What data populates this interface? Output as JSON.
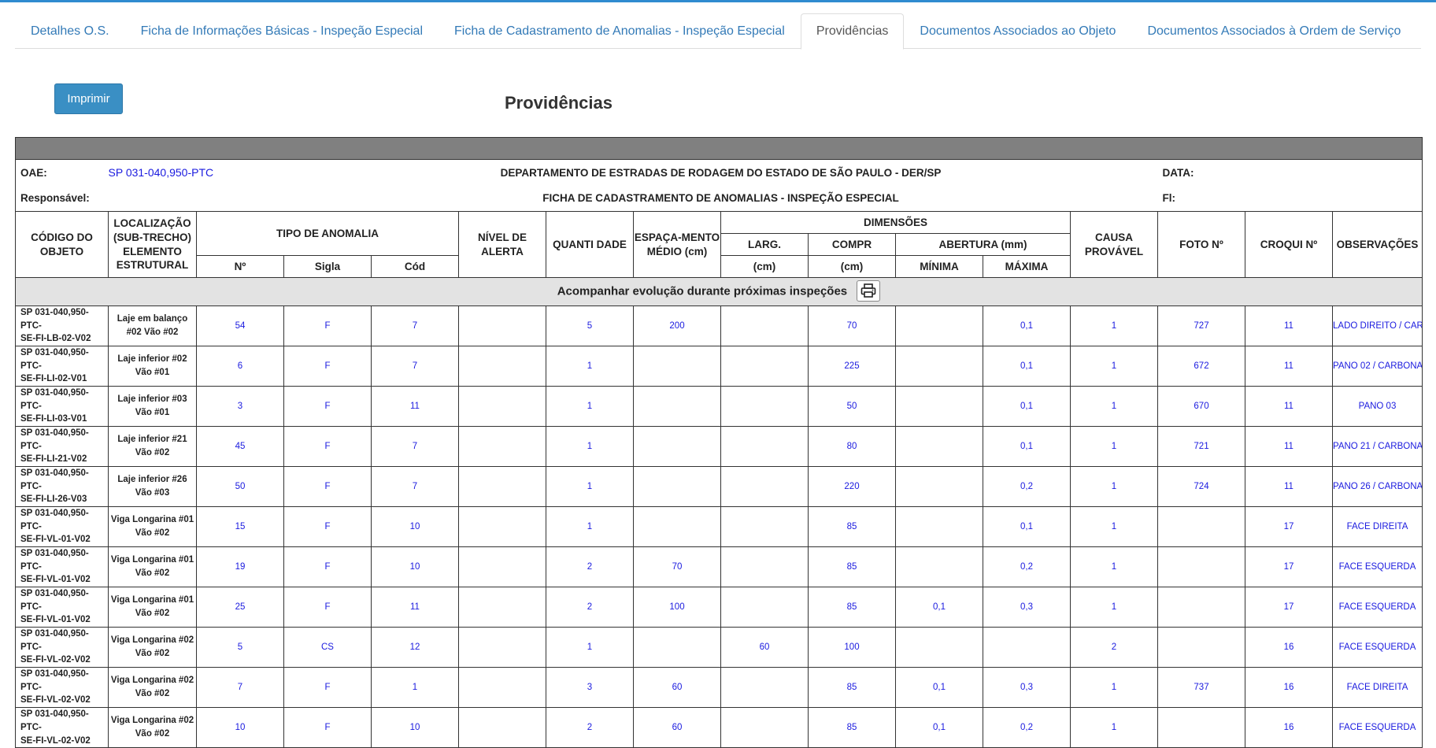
{
  "tabs": [
    {
      "label": "Detalhes O.S.",
      "active": false
    },
    {
      "label": "Ficha de Informações Básicas - Inspeção Especial",
      "active": false
    },
    {
      "label": "Ficha de Cadastramento de Anomalias - Inspeção Especial",
      "active": false
    },
    {
      "label": "Providências",
      "active": true
    },
    {
      "label": "Documentos Associados ao Objeto",
      "active": false
    },
    {
      "label": "Documentos Associados à Ordem de Serviço",
      "active": false
    }
  ],
  "toolbar": {
    "print_label": "Imprimir"
  },
  "page_title": "Providências",
  "info": {
    "oae_label": "OAE:",
    "oae_value": "SP 031-040,950-PTC",
    "department": "DEPARTAMENTO DE ESTRADAS DE RODAGEM DO ESTADO DE SÃO PAULO - DER/SP",
    "data_label": "DATA:",
    "responsavel_label": "Responsável:",
    "form_title": "FICHA DE CADASTRAMENTO DE ANOMALIAS - INSPEÇÃO ESPECIAL",
    "fl_label": "Fl:"
  },
  "headers": {
    "codigo": "CÓDIGO DO OBJETO",
    "localizacao": "LOCALIZAÇÃO (SUB-TRECHO) ELEMENTO ESTRUTURAL",
    "tipo": "TIPO DE ANOMALIA",
    "no": "Nº",
    "sigla": "Sigla",
    "cod": "Cód",
    "nivel": "NÍVEL DE ALERTA",
    "quantidade": "QUANTI DADE",
    "espacamento": "ESPAÇA-MENTO MÉDIO (cm)",
    "dimensoes": "DIMENSÕES",
    "larg": "LARG.",
    "compr": "COMPR",
    "abertura": "ABERTURA (mm)",
    "cm1": "(cm)",
    "cm2": "(cm)",
    "minima": "MÍNIMA",
    "maxima": "MÁXIMA",
    "causa": "CAUSA PROVÁVEL",
    "foto": "FOTO Nº",
    "croqui": "CROQUI Nº",
    "obs": "OBSERVAÇÕES"
  },
  "section_label": "Acompanhar evolução durante próximas inspeções",
  "section_icon": "printer-icon",
  "rows": [
    {
      "code1": "SP 031-040,950-PTC-",
      "code2": "SE-FI-LB-02-V02",
      "loc1": "Laje em balanço",
      "loc2": "#02 Vão #02",
      "no": "54",
      "sigla": "F",
      "cod": "7",
      "nivel": "",
      "qtd": "5",
      "esp": "200",
      "larg": "",
      "compr": "70",
      "min": "",
      "max": "0,1",
      "causa": "1",
      "foto": "727",
      "croqui": "11",
      "obs": "LADO  DIREITO / CAR"
    },
    {
      "code1": "SP 031-040,950-PTC-",
      "code2": "SE-FI-LI-02-V01",
      "loc1": "Laje inferior #02",
      "loc2": "Vão #01",
      "no": "6",
      "sigla": "F",
      "cod": "7",
      "nivel": "",
      "qtd": "1",
      "esp": "",
      "larg": "",
      "compr": "225",
      "min": "",
      "max": "0,1",
      "causa": "1",
      "foto": "672",
      "croqui": "11",
      "obs": "PANO 02 / CARBONA"
    },
    {
      "code1": "SP 031-040,950-PTC-",
      "code2": "SE-FI-LI-03-V01",
      "loc1": "Laje inferior #03",
      "loc2": "Vão #01",
      "no": "3",
      "sigla": "F",
      "cod": "11",
      "nivel": "",
      "qtd": "1",
      "esp": "",
      "larg": "",
      "compr": "50",
      "min": "",
      "max": "0,1",
      "causa": "1",
      "foto": "670",
      "croqui": "11",
      "obs": "PANO 03"
    },
    {
      "code1": "SP 031-040,950-PTC-",
      "code2": "SE-FI-LI-21-V02",
      "loc1": "Laje inferior #21",
      "loc2": "Vão #02",
      "no": "45",
      "sigla": "F",
      "cod": "7",
      "nivel": "",
      "qtd": "1",
      "esp": "",
      "larg": "",
      "compr": "80",
      "min": "",
      "max": "0,1",
      "causa": "1",
      "foto": "721",
      "croqui": "11",
      "obs": "PANO 21 / CARBONA"
    },
    {
      "code1": "SP 031-040,950-PTC-",
      "code2": "SE-FI-LI-26-V03",
      "loc1": "Laje inferior #26",
      "loc2": "Vão #03",
      "no": "50",
      "sigla": "F",
      "cod": "7",
      "nivel": "",
      "qtd": "1",
      "esp": "",
      "larg": "",
      "compr": "220",
      "min": "",
      "max": "0,2",
      "causa": "1",
      "foto": "724",
      "croqui": "11",
      "obs": "PANO 26 / CARBONA"
    },
    {
      "code1": "SP 031-040,950-PTC-",
      "code2": "SE-FI-VL-01-V02",
      "loc1": "Viga Longarina #01",
      "loc2": "Vão #02",
      "no": "15",
      "sigla": "F",
      "cod": "10",
      "nivel": "",
      "qtd": "1",
      "esp": "",
      "larg": "",
      "compr": "85",
      "min": "",
      "max": "0,1",
      "causa": "1",
      "foto": "",
      "croqui": "17",
      "obs": "FACE DIREITA"
    },
    {
      "code1": "SP 031-040,950-PTC-",
      "code2": "SE-FI-VL-01-V02",
      "loc1": "Viga Longarina #01",
      "loc2": "Vão #02",
      "no": "19",
      "sigla": "F",
      "cod": "10",
      "nivel": "",
      "qtd": "2",
      "esp": "70",
      "larg": "",
      "compr": "85",
      "min": "",
      "max": "0,2",
      "causa": "1",
      "foto": "",
      "croqui": "17",
      "obs": "FACE ESQUERDA"
    },
    {
      "code1": "SP 031-040,950-PTC-",
      "code2": "SE-FI-VL-01-V02",
      "loc1": "Viga Longarina #01",
      "loc2": "Vão #02",
      "no": "25",
      "sigla": "F",
      "cod": "11",
      "nivel": "",
      "qtd": "2",
      "esp": "100",
      "larg": "",
      "compr": "85",
      "min": "0,1",
      "max": "0,3",
      "causa": "1",
      "foto": "",
      "croqui": "17",
      "obs": "FACE ESQUERDA"
    },
    {
      "code1": "SP 031-040,950-PTC-",
      "code2": "SE-FI-VL-02-V02",
      "loc1": "Viga Longarina #02",
      "loc2": "Vão #02",
      "no": "5",
      "sigla": "CS",
      "cod": "12",
      "nivel": "",
      "qtd": "1",
      "esp": "",
      "larg": "60",
      "compr": "100",
      "min": "",
      "max": "",
      "causa": "2",
      "foto": "",
      "croqui": "16",
      "obs": "FACE ESQUERDA"
    },
    {
      "code1": "SP 031-040,950-PTC-",
      "code2": "SE-FI-VL-02-V02",
      "loc1": "Viga Longarina #02",
      "loc2": "Vão #02",
      "no": "7",
      "sigla": "F",
      "cod": "1",
      "nivel": "",
      "qtd": "3",
      "esp": "60",
      "larg": "",
      "compr": "85",
      "min": "0,1",
      "max": "0,3",
      "causa": "1",
      "foto": "737",
      "croqui": "16",
      "obs": "FACE DIREITA"
    },
    {
      "code1": "SP 031-040,950-PTC-",
      "code2": "SE-FI-VL-02-V02",
      "loc1": "Viga Longarina #02",
      "loc2": "Vão #02",
      "no": "10",
      "sigla": "F",
      "cod": "10",
      "nivel": "",
      "qtd": "2",
      "esp": "60",
      "larg": "",
      "compr": "85",
      "min": "0,1",
      "max": "0,2",
      "causa": "1",
      "foto": "",
      "croqui": "16",
      "obs": "FACE ESQUERDA"
    }
  ]
}
